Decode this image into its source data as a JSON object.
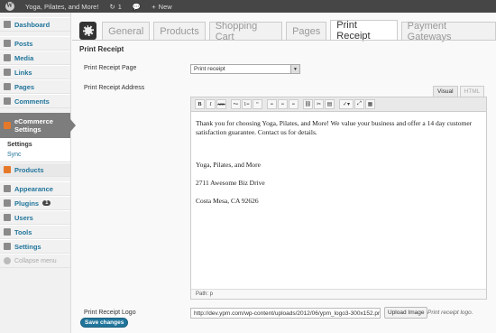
{
  "adminbar": {
    "site_name": "Yoga, Pilates, and More!",
    "updates_count": "1",
    "comments_icon": "speech-bubble-icon",
    "new_label": "New"
  },
  "sidebar": {
    "items": [
      {
        "label": "Dashboard",
        "icon": "dashboard-icon"
      },
      {
        "label": "Posts",
        "icon": "pin-icon"
      },
      {
        "label": "Media",
        "icon": "media-icon"
      },
      {
        "label": "Links",
        "icon": "link-icon"
      },
      {
        "label": "Pages",
        "icon": "page-icon"
      },
      {
        "label": "Comments",
        "icon": "comment-icon"
      },
      {
        "label": "eCommerce Settings",
        "icon": "ecommerce-icon"
      },
      {
        "label": "Products",
        "icon": "products-icon"
      },
      {
        "label": "Appearance",
        "icon": "appearance-icon"
      },
      {
        "label": "Plugins",
        "icon": "plugin-icon",
        "badge": "1"
      },
      {
        "label": "Users",
        "icon": "users-icon"
      },
      {
        "label": "Tools",
        "icon": "tools-icon"
      },
      {
        "label": "Settings",
        "icon": "settings-icon"
      },
      {
        "label": "Collapse menu",
        "icon": "collapse-icon"
      }
    ],
    "submenu": [
      "Settings",
      "Sync"
    ]
  },
  "tabs": [
    "General",
    "Products",
    "Shopping Cart",
    "Pages",
    "Print Receipt",
    "Payment Gateways"
  ],
  "active_tab": "Print Receipt",
  "section_title": "Print Receipt",
  "fields": {
    "page_label": "Print Receipt Page",
    "page_value": "Print receipt",
    "address_label": "Print Receipt Address",
    "logo_label": "Print Receipt Logo",
    "logo_value": "http://dev.ypm.com/wp-content/uploads/2012/06/ypm_logo3-300x152.pn",
    "upload_label": "Upload Image",
    "logo_hint": "Print receipt logo."
  },
  "editor": {
    "tab_visual": "Visual",
    "tab_html": "HTML",
    "paragraph1": "Thank you for choosing Yoga, Pilates, and More!  We value your business and offer a 14 day customer satisfaction guarantee.   Contact us for details.",
    "line1": "Yoga, Pilates, and More",
    "line2": "2711 Awesome Biz Drive",
    "line3": "Costa Mesa, CA 92626",
    "path": "Path: p",
    "toolbar": [
      "B",
      "I",
      "ABC",
      "•≡",
      "1≡",
      "“",
      "≡",
      "≡",
      "≡",
      "⛓",
      "✂",
      "▤",
      "✓▾",
      "⤢",
      "▦"
    ]
  },
  "save_label": "Save changes"
}
